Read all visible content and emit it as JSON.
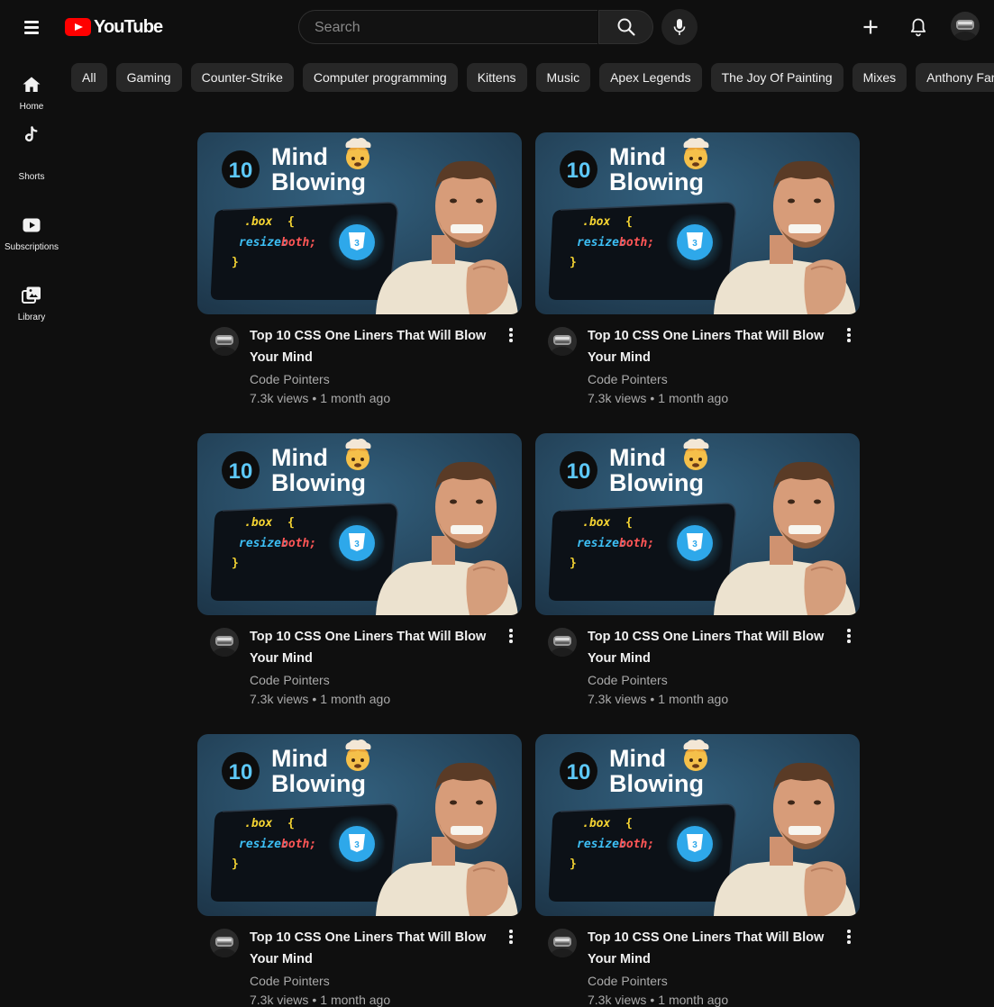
{
  "header": {
    "logo_text": "YouTube",
    "search_placeholder": "Search"
  },
  "sidebar": {
    "items": [
      {
        "label": "Home",
        "icon": "home-icon"
      },
      {
        "label": "Shorts",
        "icon": "shorts-icon"
      },
      {
        "label": "Subscriptions",
        "icon": "subscriptions-icon"
      },
      {
        "label": "Library",
        "icon": "library-icon"
      }
    ]
  },
  "chips": [
    "All",
    "Gaming",
    "Counter-Strike",
    "Computer programming",
    "Kittens",
    "Music",
    "Apex Legends",
    "The Joy Of Painting",
    "Mixes",
    "Anthony Fantano"
  ],
  "thumbnail": {
    "number": "10",
    "line1": "Mind",
    "line2": "Blowing",
    "code_selector": ".box",
    "code_open": "{",
    "code_prop": "resize:",
    "code_value": "both;",
    "code_close": "}",
    "badge_text": "3",
    "bg_color": "#2a4e6c",
    "accent_color": "#3dbff5"
  },
  "videos": [
    {
      "title": "Top 10 CSS One Liners That Will Blow Your Mind",
      "channel": "Code Pointers",
      "views": "7.3k views",
      "age": "1 month ago"
    },
    {
      "title": "Top 10 CSS One Liners That Will Blow Your Mind",
      "channel": "Code Pointers",
      "views": "7.3k views",
      "age": "1 month ago"
    },
    {
      "title": "Top 10 CSS One Liners That Will Blow Your Mind",
      "channel": "Code Pointers",
      "views": "7.3k views",
      "age": "1 month ago"
    },
    {
      "title": "Top 10 CSS One Liners That Will Blow Your Mind",
      "channel": "Code Pointers",
      "views": "7.3k views",
      "age": "1 month ago"
    },
    {
      "title": "Top 10 CSS One Liners That Will Blow Your Mind",
      "channel": "Code Pointers",
      "views": "7.3k views",
      "age": "1 month ago"
    },
    {
      "title": "Top 10 CSS One Liners That Will Blow Your Mind",
      "channel": "Code Pointers",
      "views": "7.3k views",
      "age": "1 month ago"
    }
  ]
}
